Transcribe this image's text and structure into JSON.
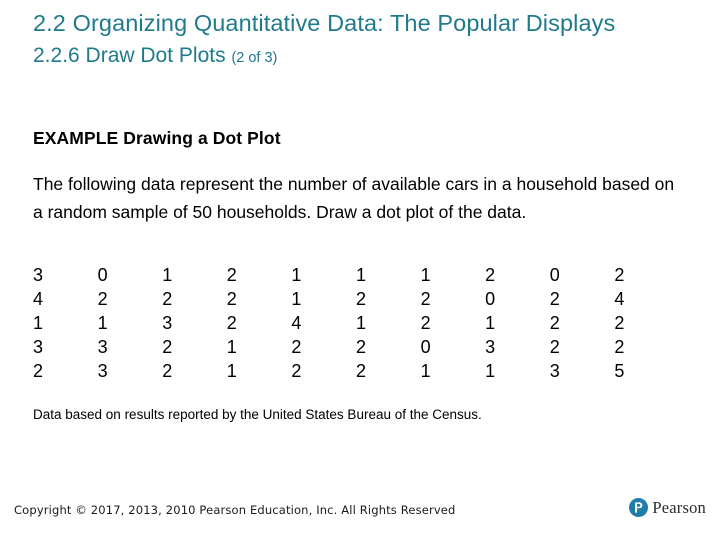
{
  "slide": {
    "title": "2.2 Organizing Quantitative Data: The Popular Displays",
    "subtitle_main": "2.2.6 Draw Dot Plots",
    "subtitle_paren": "(2 of 3)",
    "title_color": "#1f7a8c"
  },
  "example": {
    "heading": "EXAMPLE Drawing a Dot Plot",
    "prompt": "The following data represent the number of available cars in a household based on a random sample of 50 households. Draw a dot plot of the data."
  },
  "data_table": {
    "rows": [
      [
        "3",
        "0",
        "1",
        "2",
        "1",
        "1",
        "1",
        "2",
        "0",
        "2"
      ],
      [
        "4",
        "2",
        "2",
        "2",
        "1",
        "2",
        "2",
        "0",
        "2",
        "4"
      ],
      [
        "1",
        "1",
        "3",
        "2",
        "4",
        "1",
        "2",
        "1",
        "2",
        "2"
      ],
      [
        "3",
        "3",
        "2",
        "1",
        "2",
        "2",
        "0",
        "3",
        "2",
        "2"
      ],
      [
        "2",
        "3",
        "2",
        "1",
        "2",
        "2",
        "1",
        "1",
        "3",
        "5"
      ]
    ]
  },
  "source_note": "Data based on results reported by the United States Bureau of the Census.",
  "footer": {
    "copyright": "Copyright © 2017, 2013, 2010 Pearson Education, Inc. All Rights Reserved",
    "logo_text": "Pearson",
    "logo_color": "#1d7ea8"
  }
}
